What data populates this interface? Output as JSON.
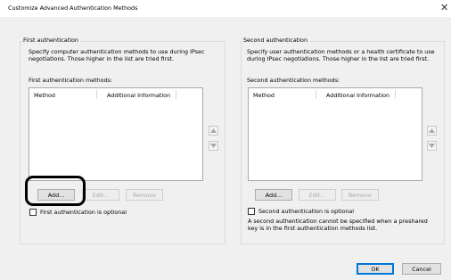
{
  "dialog": {
    "title": "Customize Advanced Authentication Methods",
    "close_glyph": "✕"
  },
  "first": {
    "group_title": "First authentication",
    "description": "Specify computer authentication methods to use during IPsec negotiations.  Those higher in the list are tried first.",
    "list_label": "First authentication methods:",
    "columns": [
      "Method",
      "Additional Information"
    ],
    "buttons": {
      "add": "Add...",
      "edit": "Edit...",
      "remove": "Remove"
    },
    "optional_label": "First authentication is optional",
    "optional_checked": false
  },
  "second": {
    "group_title": "Second authentication",
    "description": "Specify user authentication methods or a health certificate to use during IPsec negotiations.  Those higher in the list are tried first.",
    "list_label": "Second authentication methods:",
    "columns": [
      "Method",
      "Additional Information"
    ],
    "buttons": {
      "add": "Add...",
      "edit": "Edit...",
      "remove": "Remove"
    },
    "optional_label": "Second authentication is optional",
    "optional_checked": false,
    "note": "A second authentication cannot be specified when a preshared key is in the first authentication methods list."
  },
  "footer": {
    "ok": "OK",
    "cancel": "Cancel"
  },
  "icons": {
    "move_up": "triangle-up-icon",
    "move_down": "triangle-down-icon"
  },
  "colors": {
    "focus": "#0078d7",
    "highlight_ring": "#000000"
  }
}
